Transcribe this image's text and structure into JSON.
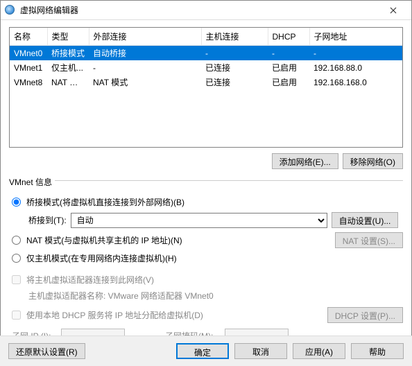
{
  "window": {
    "title": "虚拟网络编辑器"
  },
  "table": {
    "columns": [
      "名称",
      "类型",
      "外部连接",
      "主机连接",
      "DHCP",
      "子网地址"
    ],
    "rows": [
      {
        "name": "VMnet0",
        "type": "桥接模式",
        "ext": "自动桥接",
        "host": "-",
        "dhcp": "-",
        "subnet": "-",
        "selected": true
      },
      {
        "name": "VMnet1",
        "type": "仅主机...",
        "ext": "-",
        "host": "已连接",
        "dhcp": "已启用",
        "subnet": "192.168.88.0",
        "selected": false
      },
      {
        "name": "VMnet8",
        "type": "NAT 模式",
        "ext": "NAT 模式",
        "host": "已连接",
        "dhcp": "已启用",
        "subnet": "192.168.168.0",
        "selected": false
      }
    ]
  },
  "buttons": {
    "add": "添加网络(E)...",
    "remove": "移除网络(O)",
    "autoSetup": "自动设置(U)...",
    "natSetup": "NAT 设置(S)...",
    "dhcpSetup": "DHCP 设置(P)...",
    "restore": "还原默认设置(R)",
    "ok": "确定",
    "cancel": "取消",
    "apply": "应用(A)",
    "help": "帮助"
  },
  "group": {
    "title": "VMnet 信息",
    "radioBridge": "桥接模式(将虚拟机直接连接到外部网络)(B)",
    "bridgeToLabel": "桥接到(T):",
    "bridgeToValue": "自动",
    "radioNat": "NAT 模式(与虚拟机共享主机的 IP 地址)(N)",
    "radioHostOnly": "仅主机模式(在专用网络内连接虚拟机)(H)",
    "chkHostAdapter": "将主机虚拟适配器连接到此网络(V)",
    "hostAdapterName": "主机虚拟适配器名称: VMware 网络适配器 VMnet0",
    "chkDhcp": "使用本地 DHCP 服务将 IP 地址分配给虚拟机(D)",
    "subnetIpLabel": "子网 IP (I):",
    "subnetMaskLabel": "子网掩码(M):"
  }
}
